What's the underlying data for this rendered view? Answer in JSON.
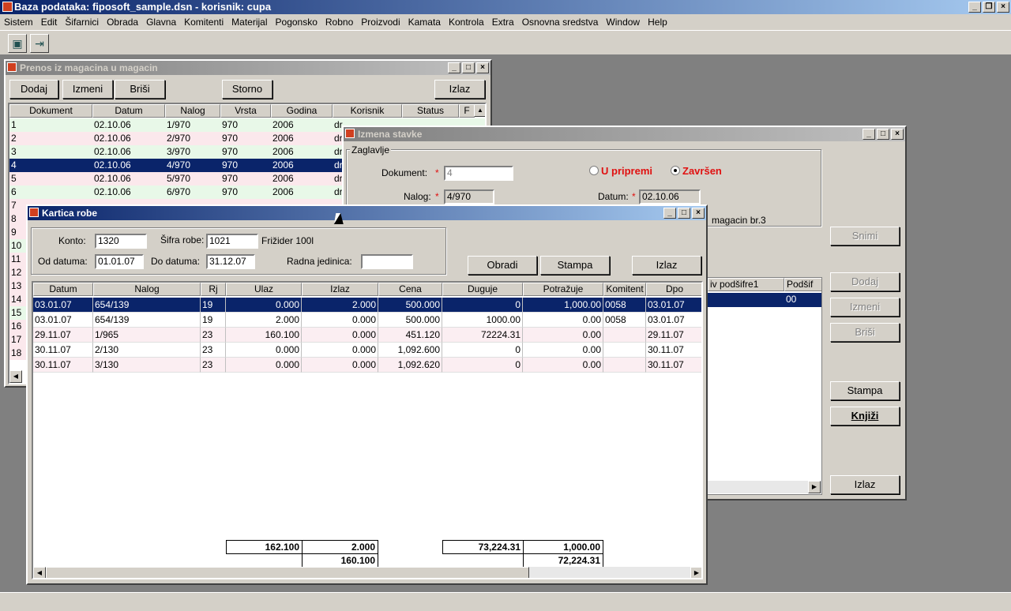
{
  "app": {
    "title": "Baza podataka: fiposoft_sample.dsn  -  korisnik: cupa"
  },
  "menu": [
    "Sistem",
    "Edit",
    "Šifarnici",
    "Obrada",
    "Glavna",
    "Komitenti",
    "Materijal",
    "Pogonsko",
    "Robno",
    "Proizvodi",
    "Kamata",
    "Kontrola",
    "Extra",
    "Osnovna sredstva",
    "Window",
    "Help"
  ],
  "prenos": {
    "title": "Prenos iz magacina u magacin",
    "buttons": {
      "dodaj": "Dodaj",
      "izmeni": "Izmeni",
      "brisi": "Briši",
      "storno": "Storno",
      "izlaz": "Izlaz"
    },
    "columns": [
      "Dokument",
      "Datum",
      "Nalog",
      "Vrsta",
      "Godina",
      "Korisnik",
      "Status",
      "F"
    ],
    "rows": [
      {
        "dok": "1",
        "datum": "02.10.06",
        "nalog": "1/970",
        "vrsta": "970",
        "godina": "2006",
        "korisnik": "dr",
        "status": "",
        "f": ""
      },
      {
        "dok": "2",
        "datum": "02.10.06",
        "nalog": "2/970",
        "vrsta": "970",
        "godina": "2006",
        "korisnik": "dr",
        "status": "",
        "f": ""
      },
      {
        "dok": "3",
        "datum": "02.10.06",
        "nalog": "3/970",
        "vrsta": "970",
        "godina": "2006",
        "korisnik": "dr",
        "status": "",
        "f": ""
      },
      {
        "dok": "4",
        "datum": "02.10.06",
        "nalog": "4/970",
        "vrsta": "970",
        "godina": "2006",
        "korisnik": "dr",
        "status": "",
        "f": ""
      },
      {
        "dok": "5",
        "datum": "02.10.06",
        "nalog": "5/970",
        "vrsta": "970",
        "godina": "2006",
        "korisnik": "dr",
        "status": "",
        "f": ""
      },
      {
        "dok": "6",
        "datum": "02.10.06",
        "nalog": "6/970",
        "vrsta": "970",
        "godina": "2006",
        "korisnik": "dr",
        "status": "",
        "f": ""
      }
    ],
    "more_rows": [
      "7",
      "8",
      "9",
      "10",
      "11",
      "12",
      "13",
      "14",
      "15",
      "16",
      "17",
      "18"
    ]
  },
  "izmena": {
    "title": "Izmena stavke",
    "group": "Zaglavlje",
    "dokument_label": "Dokument:",
    "dokument_value": "4",
    "nalog_label": "Nalog:",
    "nalog_value": "4/970",
    "datum_label": "Datum:",
    "datum_value": "02.10.06",
    "radio_pripremi": "U pripremi",
    "radio_zavrsen": "Završen",
    "magacin_text": "magacin br.3",
    "star": "*",
    "grid_cols": [
      "iv podšifre1",
      "Podšif"
    ],
    "grid_row": [
      "",
      "00"
    ],
    "buttons": {
      "snimi": "Snimi",
      "dodaj": "Dodaj",
      "izmeni": "Izmeni",
      "brisi": "Briši",
      "stampa": "Stampa",
      "knjizi": "Knjiži",
      "izlaz": "Izlaz"
    }
  },
  "kartica": {
    "title": "Kartica robe",
    "konto_label": "Konto:",
    "konto_value": "1320",
    "sifra_label": "Šifra robe:",
    "sifra_value": "1021",
    "sifra_name": "Frižider 100l",
    "od_label": "Od datuma:",
    "od_value": "01.01.07",
    "do_label": "Do datuma:",
    "do_value": "31.12.07",
    "rj_label": "Radna jedinica:",
    "rj_value": "",
    "buttons": {
      "obradi": "Obradi",
      "stampa": "Stampa",
      "izlaz": "Izlaz"
    },
    "columns": [
      "Datum",
      "Nalog",
      "Rj",
      "Ulaz",
      "Izlaz",
      "Cena",
      "Duguje",
      "Potražuje",
      "Komitent",
      "Dpo"
    ],
    "rows": [
      {
        "datum": "03.01.07",
        "nalog": "654/139",
        "rj": "19",
        "ulaz": "0.000",
        "izlaz": "2.000",
        "cena": "500.000",
        "duguje": "0",
        "potrazuje": "1,000.00",
        "komitent": "0058",
        "dpo": "03.01.07"
      },
      {
        "datum": "03.01.07",
        "nalog": "654/139",
        "rj": "19",
        "ulaz": "2.000",
        "izlaz": "0.000",
        "cena": "500.000",
        "duguje": "1000.00",
        "potrazuje": "0.00",
        "komitent": "0058",
        "dpo": "03.01.07"
      },
      {
        "datum": "29.11.07",
        "nalog": "1/965",
        "rj": "23",
        "ulaz": "160.100",
        "izlaz": "0.000",
        "cena": "451.120",
        "duguje": "72224.31",
        "potrazuje": "0.00",
        "komitent": "",
        "dpo": "29.11.07"
      },
      {
        "datum": "30.11.07",
        "nalog": "2/130",
        "rj": "23",
        "ulaz": "0.000",
        "izlaz": "0.000",
        "cena": "1,092.600",
        "duguje": "0",
        "potrazuje": "0.00",
        "komitent": "",
        "dpo": "30.11.07"
      },
      {
        "datum": "30.11.07",
        "nalog": "3/130",
        "rj": "23",
        "ulaz": "0.000",
        "izlaz": "0.000",
        "cena": "1,092.620",
        "duguje": "0",
        "potrazuje": "0.00",
        "komitent": "",
        "dpo": "30.11.07"
      }
    ],
    "totals": {
      "ulaz": "162.100",
      "izlaz": "2.000",
      "saldo_kol": "160.100",
      "duguje": "73,224.31",
      "potrazuje": "1,000.00",
      "saldo_iznos": "72,224.31"
    }
  },
  "colors": {
    "selected": "#0a246a",
    "row_green": "#e8f8e8",
    "row_pink": "#fbe8ec",
    "title_active": "#0a246a"
  }
}
